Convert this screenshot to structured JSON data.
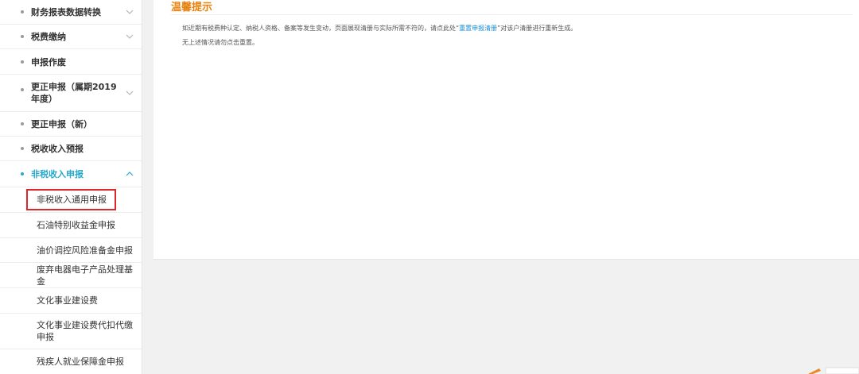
{
  "sidebar": {
    "menu": [
      {
        "label": "财务报表数据转换",
        "expandable": true,
        "expanded": false
      },
      {
        "label": "税费缴纳",
        "expandable": true,
        "expanded": false
      },
      {
        "label": "申报作废",
        "expandable": false
      },
      {
        "label": "更正申报（属期2019年度）",
        "expandable": true,
        "expanded": false
      },
      {
        "label": "更正申报（新）",
        "expandable": false
      },
      {
        "label": "税收收入预报",
        "expandable": false
      },
      {
        "label": "非税收入申报",
        "expandable": true,
        "expanded": true,
        "active": true
      }
    ],
    "submenu": [
      {
        "label": "非税收入通用申报",
        "highlighted": true
      },
      {
        "label": "石油特别收益金申报"
      },
      {
        "label": "油价调控风险准备金申报"
      },
      {
        "label": "废弃电器电子产品处理基金"
      },
      {
        "label": "文化事业建设费"
      },
      {
        "label": "文化事业建设费代扣代缴申报"
      },
      {
        "label": "残疾人就业保障金申报"
      }
    ]
  },
  "notice": {
    "title": "温馨提示",
    "line1_prefix": "如近期有税费种认定、纳税人资格、备案等发生变动，页面展现清册与实际所需不符的，请点此处“",
    "line1_link": "重置申报清册",
    "line1_suffix": "”对该户清册进行重新生成。",
    "line2": "无上述情况请勿点击重置。"
  },
  "colors": {
    "accent": "#2aa8c9",
    "title": "#e8820e",
    "link": "#1a8fd6",
    "highlight_box": "#e0262d"
  }
}
